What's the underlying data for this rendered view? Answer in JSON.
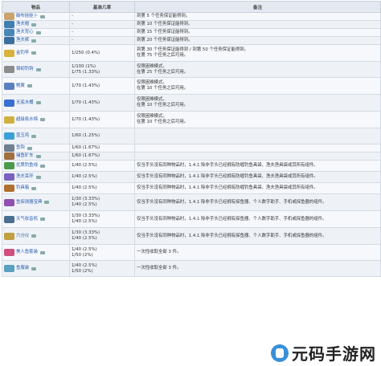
{
  "header": {
    "col_item": "物品",
    "col_rate": "基准几率",
    "col_note": "备注"
  },
  "rows": [
    {
      "name": "破布娃娃卜",
      "rate": [
        "-"
      ],
      "note": "到第 5 个任务保证能得到。",
      "color": "#c9a36b"
    },
    {
      "name": "渔夫帽",
      "rate": [
        "-"
      ],
      "note": "到第 10 个任务保证能得到。",
      "color": "#3f7fb0"
    },
    {
      "name": "渔夫背心",
      "rate": [
        "-"
      ],
      "note": "到第 15 个任务保证能得到。",
      "color": "#4a86b8"
    },
    {
      "name": "渔夫裤",
      "rate": [
        "-"
      ],
      "note": "到第 20 个任务保证能得到。",
      "color": "#3b6f9e"
    },
    {
      "name": "金钓竿",
      "rate": [
        "1/250 (0.4%)"
      ],
      "note": "到第 30 个任务保证能得到 / 到第 50 个任务保证能得到。",
      "note2": "在第 75 个任务之后可用。",
      "color": "#d8b23a"
    },
    {
      "name": "钢纫钓钩",
      "rate": [
        "1/100 (1%)",
        "1/75 (1.33%)"
      ],
      "note": "仅限困难模式。",
      "note2": "在第 25 个任务之后可用。",
      "color": "#8c8c8c"
    },
    {
      "name": "鳍翼",
      "rate": [
        "1/70 (1.43%)"
      ],
      "note": "仅限困难模式。",
      "note2": "在第 10 个任务之后可用。",
      "color": "#5a7fc0"
    },
    {
      "name": "无底水桶",
      "rate": [
        "1/70 (1.43%)"
      ],
      "note": "仅限困难模式。",
      "note2": "在第 10 个任务之后可用。",
      "color": "#3a6fd0"
    },
    {
      "name": "超级吸水棉",
      "rate": [
        "1/70 (1.43%)"
      ],
      "note": "仅限困难模式。",
      "note2": "在第 10 个任务之后可用。",
      "color": "#d0b040"
    },
    {
      "name": "蓝玉鸡",
      "rate": [
        "1/60 (1.25%)"
      ],
      "note": "",
      "color": "#3aa0d8"
    },
    {
      "name": "鱼钩",
      "rate": [
        "1/60 (1.67%)"
      ],
      "note": "",
      "color": "#6f7f8f"
    },
    {
      "name": "捕鱼矿车",
      "rate": [
        "1/60 (1.67%)"
      ],
      "note": "",
      "color": "#a07040"
    },
    {
      "name": "优质钓鱼线",
      "rate": [
        "1/40 (2.5%)"
      ],
      "note": "仅当手头没有同种物品时，1.4.1 除非手头已经拥有防缠钓鱼具袋、渔夫渔具袋或其所有组件。",
      "color": "#4a9a4a"
    },
    {
      "name": "渔夫耳环",
      "rate": [
        "1/40 (2.5%)"
      ],
      "note": "仅当手头没有同种物品时，1.4.1 除非手头已经拥有防缠钓鱼具袋、渔夫渔具袋或其所有组件。",
      "color": "#7a60c0"
    },
    {
      "name": "钓具箱",
      "rate": [
        "1/40 (2.5%)"
      ],
      "note": "仅当手头没有同种物品时，1.4.1 除非手头已经拥有防缠钓鱼具袋、渔夫渔具袋或其所有组件。",
      "color": "#b07030"
    },
    {
      "name": "鱼探测器宝典",
      "rate": [
        "1/30 (3.33%)",
        "1/40 (2.5%)"
      ],
      "note": "仅当手头没有同种物品时，1.4.1 除非手头已经拥有探鱼器、个人数字助手、手机或探鱼器的组件。",
      "color": "#9050b0"
    },
    {
      "name": "天气收音机",
      "rate": [
        "1/30 (3.33%)",
        "1/40 (2.5%)"
      ],
      "note": "仅当手头没有同种物品时，1.4.1 除非手头已经拥有探鱼器、个人数字助手、手机或探鱼器的组件。",
      "color": "#4a6f90"
    },
    {
      "name": "六分仪",
      "rate": [
        "1/30 (3.33%)",
        "1/40 (2.5%)"
      ],
      "note": "仅当手头没有同种物品时，1.4.1 除非手头已经拥有探鱼器、个人数字助手、手机或探鱼器的组件。",
      "color": "#c0a040"
    },
    {
      "name": "美人鱼套装",
      "rate": [
        "1/40 (2.5%)",
        "1/50 (2%)"
      ],
      "note": "一次性收取全部 3 件。",
      "color": "#d05080"
    },
    {
      "name": "鱼服装",
      "rate": [
        "1/40 (2.5%)",
        "1/50 (2%)"
      ],
      "note": "一次性收取全部 3 件。",
      "color": "#5aa0c0"
    }
  ],
  "watermark": {
    "text": "元码手游网"
  }
}
